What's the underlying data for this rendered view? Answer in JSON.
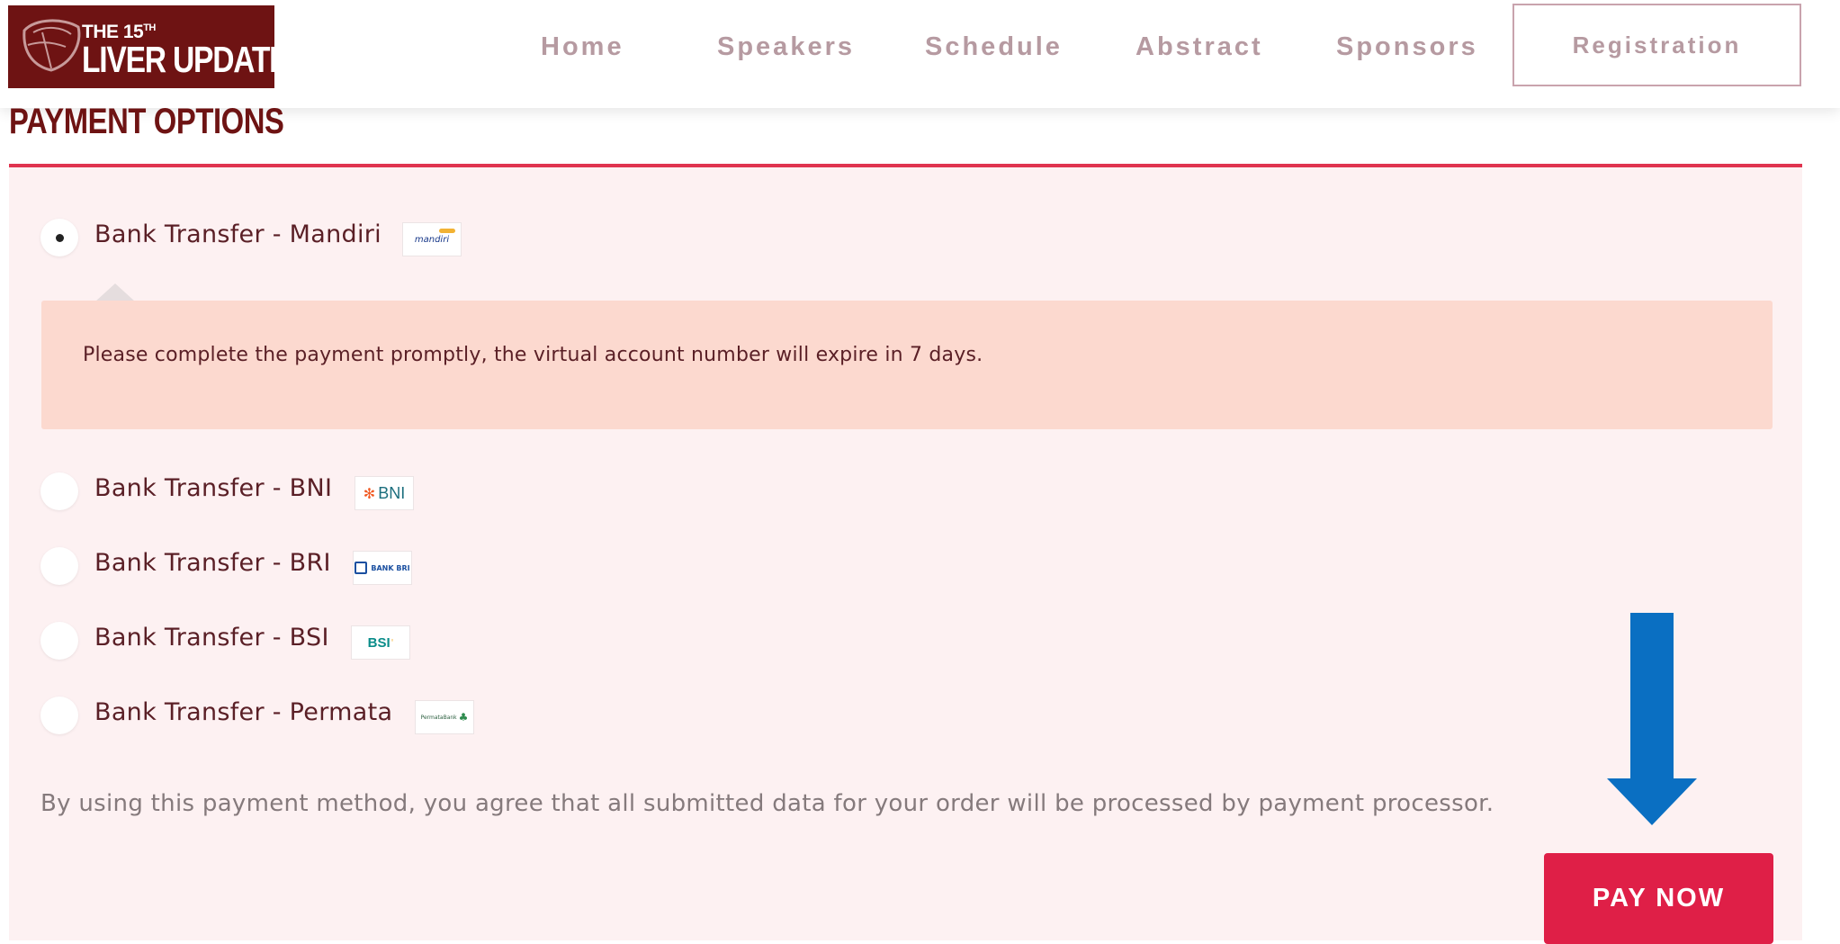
{
  "header": {
    "logo_line1": "THE 15",
    "logo_sup": "TH",
    "logo_line2": "LIVER UPDATE",
    "nav": [
      "Home",
      "Speakers",
      "Schedule",
      "Abstract",
      "Sponsors"
    ],
    "registration_label": "Registration"
  },
  "section": {
    "title": "PAYMENT OPTIONS"
  },
  "payment_options": [
    {
      "label": "Bank Transfer - Mandiri",
      "logo_text": "mandiri",
      "selected": true
    },
    {
      "label": "Bank Transfer - BNI",
      "logo_text": "BNI",
      "selected": false
    },
    {
      "label": "Bank Transfer - BRI",
      "logo_text": "BANK BRI",
      "selected": false
    },
    {
      "label": "Bank Transfer - BSI",
      "logo_text": "BSI",
      "selected": false
    },
    {
      "label": "Bank Transfer - Permata",
      "logo_text": "PermataBank",
      "selected": false
    }
  ],
  "notice": "Please complete the payment promptly, the virtual account number will expire in 7 days.",
  "terms": "By using this payment method, you agree that all submitted data for your order will be processed by payment processor.",
  "pay_button_label": "PAY NOW",
  "colors": {
    "brand_dark": "#6e1313",
    "accent_red": "#df1f47",
    "panel_bg": "#fdf1f2",
    "notice_bg": "#fcd9cf",
    "annotation_arrow": "#0a6fc2"
  },
  "icons": {
    "logo": "liver-logo-icon",
    "annotation": "arrow-down-icon"
  }
}
